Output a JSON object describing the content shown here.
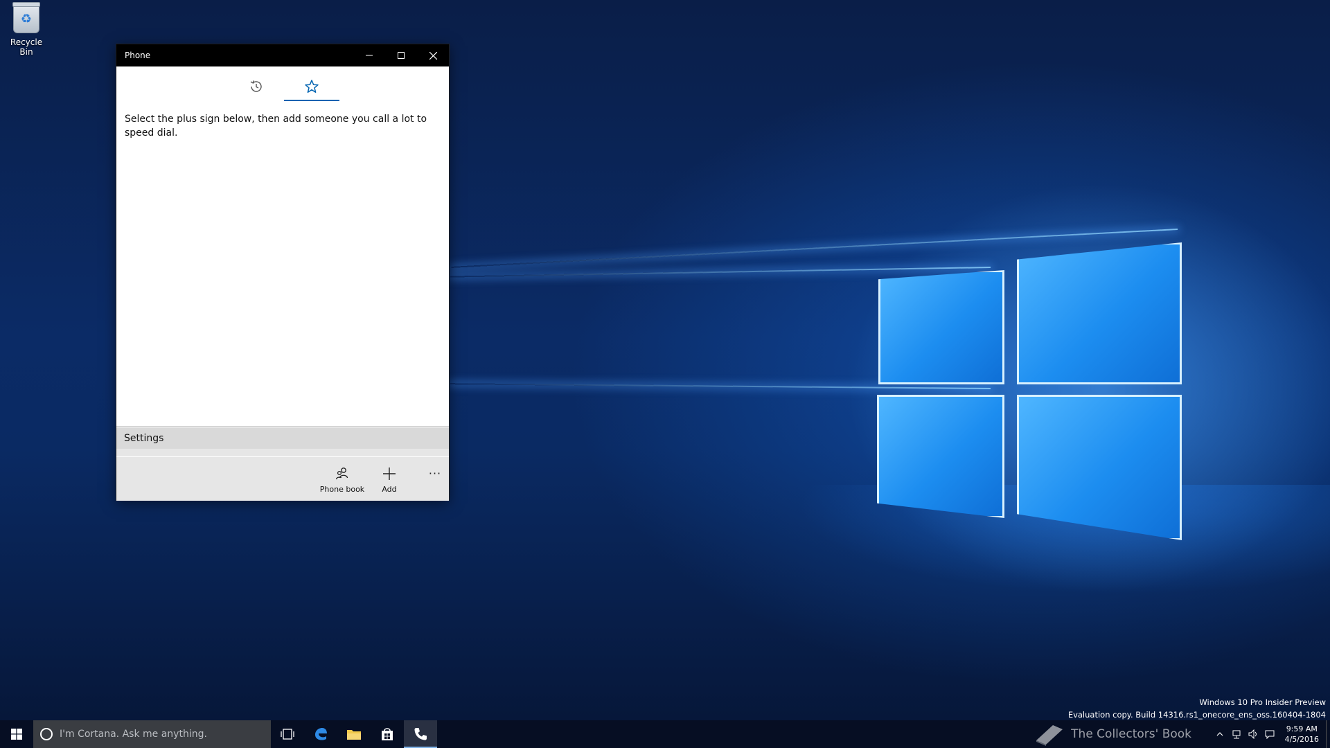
{
  "desktop": {
    "recycle_bin_label": "Recycle Bin",
    "watermark": {
      "line1": "Windows 10 Pro Insider Preview",
      "line2": "Evaluation copy. Build 14316.rs1_onecore_ens_oss.160404-1804"
    },
    "logo_text": "The Collectors' Book"
  },
  "window": {
    "title": "Phone",
    "tabs": [
      {
        "icon": "history-icon",
        "active": false
      },
      {
        "icon": "star-icon",
        "active": true
      }
    ],
    "message": "Select the plus sign below, then add someone you call a lot to speed dial.",
    "settings_label": "Settings",
    "commands": {
      "phone_book": "Phone book",
      "add": "Add",
      "more": "···"
    }
  },
  "taskbar": {
    "search_placeholder": "I'm Cortana. Ask me anything.",
    "clock_time": "9:59 AM",
    "clock_date": "4/5/2016",
    "pinned": [
      "task-view-icon",
      "edge-icon",
      "file-explorer-icon",
      "store-icon",
      "phone-icon"
    ]
  },
  "colors": {
    "accent": "#0063b1",
    "titlebar": "#000000",
    "taskbar": "#0b1226"
  }
}
